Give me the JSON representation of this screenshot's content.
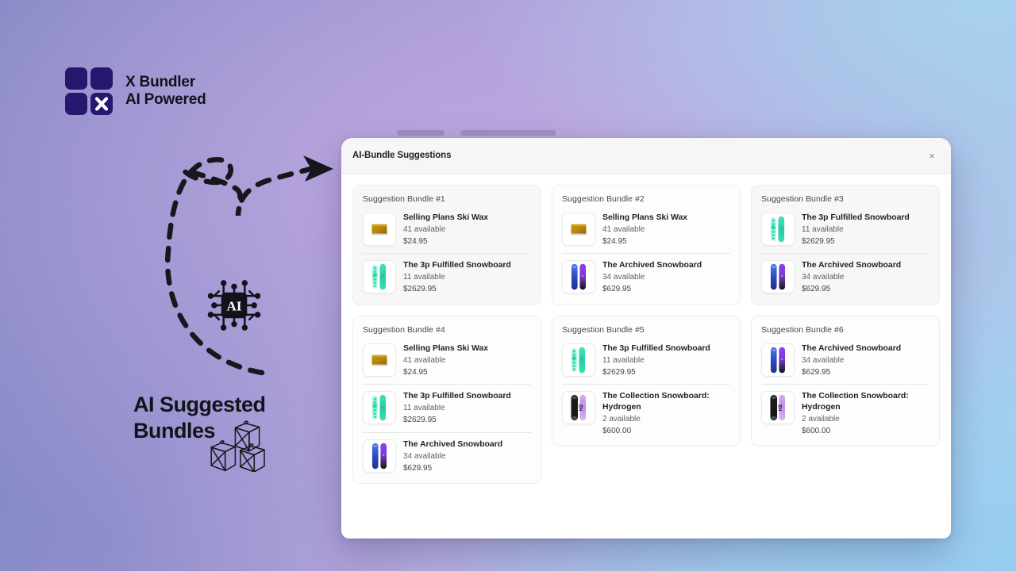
{
  "brand": {
    "logo_icon": "x-bundler-grid-logo",
    "line1": "X Bundler",
    "line2": "AI Powered"
  },
  "promo": {
    "chip_icon": "ai-chip-icon",
    "chip_label": "AI",
    "caption": "AI Suggested Bundles",
    "boxes_icon": "packages-icon",
    "arrow_icon": "dashed-curved-arrow-icon"
  },
  "modal": {
    "title": "AI-Bundle Suggestions",
    "close_label": "×",
    "close_icon": "close-icon"
  },
  "colors": {
    "brand_navy": "#26186e",
    "modal_header_bg": "#f6f6f7",
    "card_bg": "#f7f7f7",
    "gradient_left": "#7b84c0",
    "gradient_mid": "#b9a8dd",
    "gradient_right": "#a7d0ee"
  },
  "bundles": [
    {
      "title": "Suggestion Bundle #1",
      "style": "filled",
      "products": [
        {
          "name": "Selling Plans Ski Wax",
          "stock": "41 available",
          "price": "$24.95",
          "thumb": "ski-wax-thumb"
        },
        {
          "name": "The 3p Fulfilled Snowboard",
          "stock": "11 available",
          "price": "$2629.95",
          "thumb": "teal-snowboard-thumb"
        }
      ]
    },
    {
      "title": "Suggestion Bundle #2",
      "style": "plain",
      "products": [
        {
          "name": "Selling Plans Ski Wax",
          "stock": "41 available",
          "price": "$24.95",
          "thumb": "ski-wax-thumb"
        },
        {
          "name": "The Archived Snowboard",
          "stock": "34 available",
          "price": "$629.95",
          "thumb": "blue-purple-snowboard-thumb"
        }
      ]
    },
    {
      "title": "Suggestion Bundle #3",
      "style": "filled",
      "products": [
        {
          "name": "The 3p Fulfilled Snowboard",
          "stock": "11 available",
          "price": "$2629.95",
          "thumb": "teal-snowboard-thumb"
        },
        {
          "name": "The Archived Snowboard",
          "stock": "34 available",
          "price": "$629.95",
          "thumb": "blue-purple-snowboard-thumb"
        }
      ]
    },
    {
      "title": "Suggestion Bundle #4",
      "style": "plain",
      "products": [
        {
          "name": "Selling Plans Ski Wax",
          "stock": "41 available",
          "price": "$24.95",
          "thumb": "ski-wax-thumb"
        },
        {
          "name": "The 3p Fulfilled Snowboard",
          "stock": "11 available",
          "price": "$2629.95",
          "thumb": "teal-snowboard-thumb"
        },
        {
          "name": "The Archived Snowboard",
          "stock": "34 available",
          "price": "$629.95",
          "thumb": "blue-purple-snowboard-thumb"
        }
      ]
    },
    {
      "title": "Suggestion Bundle #5",
      "style": "plain",
      "products": [
        {
          "name": "The 3p Fulfilled Snowboard",
          "stock": "11 available",
          "price": "$2629.95",
          "thumb": "teal-snowboard-thumb"
        },
        {
          "name": "The Collection Snowboard: Hydrogen",
          "stock": "2 available",
          "price": "$600.00",
          "thumb": "hydrogen-snowboard-thumb"
        }
      ]
    },
    {
      "title": "Suggestion Bundle #6",
      "style": "plain",
      "products": [
        {
          "name": "The Archived Snowboard",
          "stock": "34 available",
          "price": "$629.95",
          "thumb": "blue-purple-snowboard-thumb"
        },
        {
          "name": "The Collection Snowboard: Hydrogen",
          "stock": "2 available",
          "price": "$600.00",
          "thumb": "hydrogen-snowboard-thumb"
        }
      ]
    }
  ]
}
